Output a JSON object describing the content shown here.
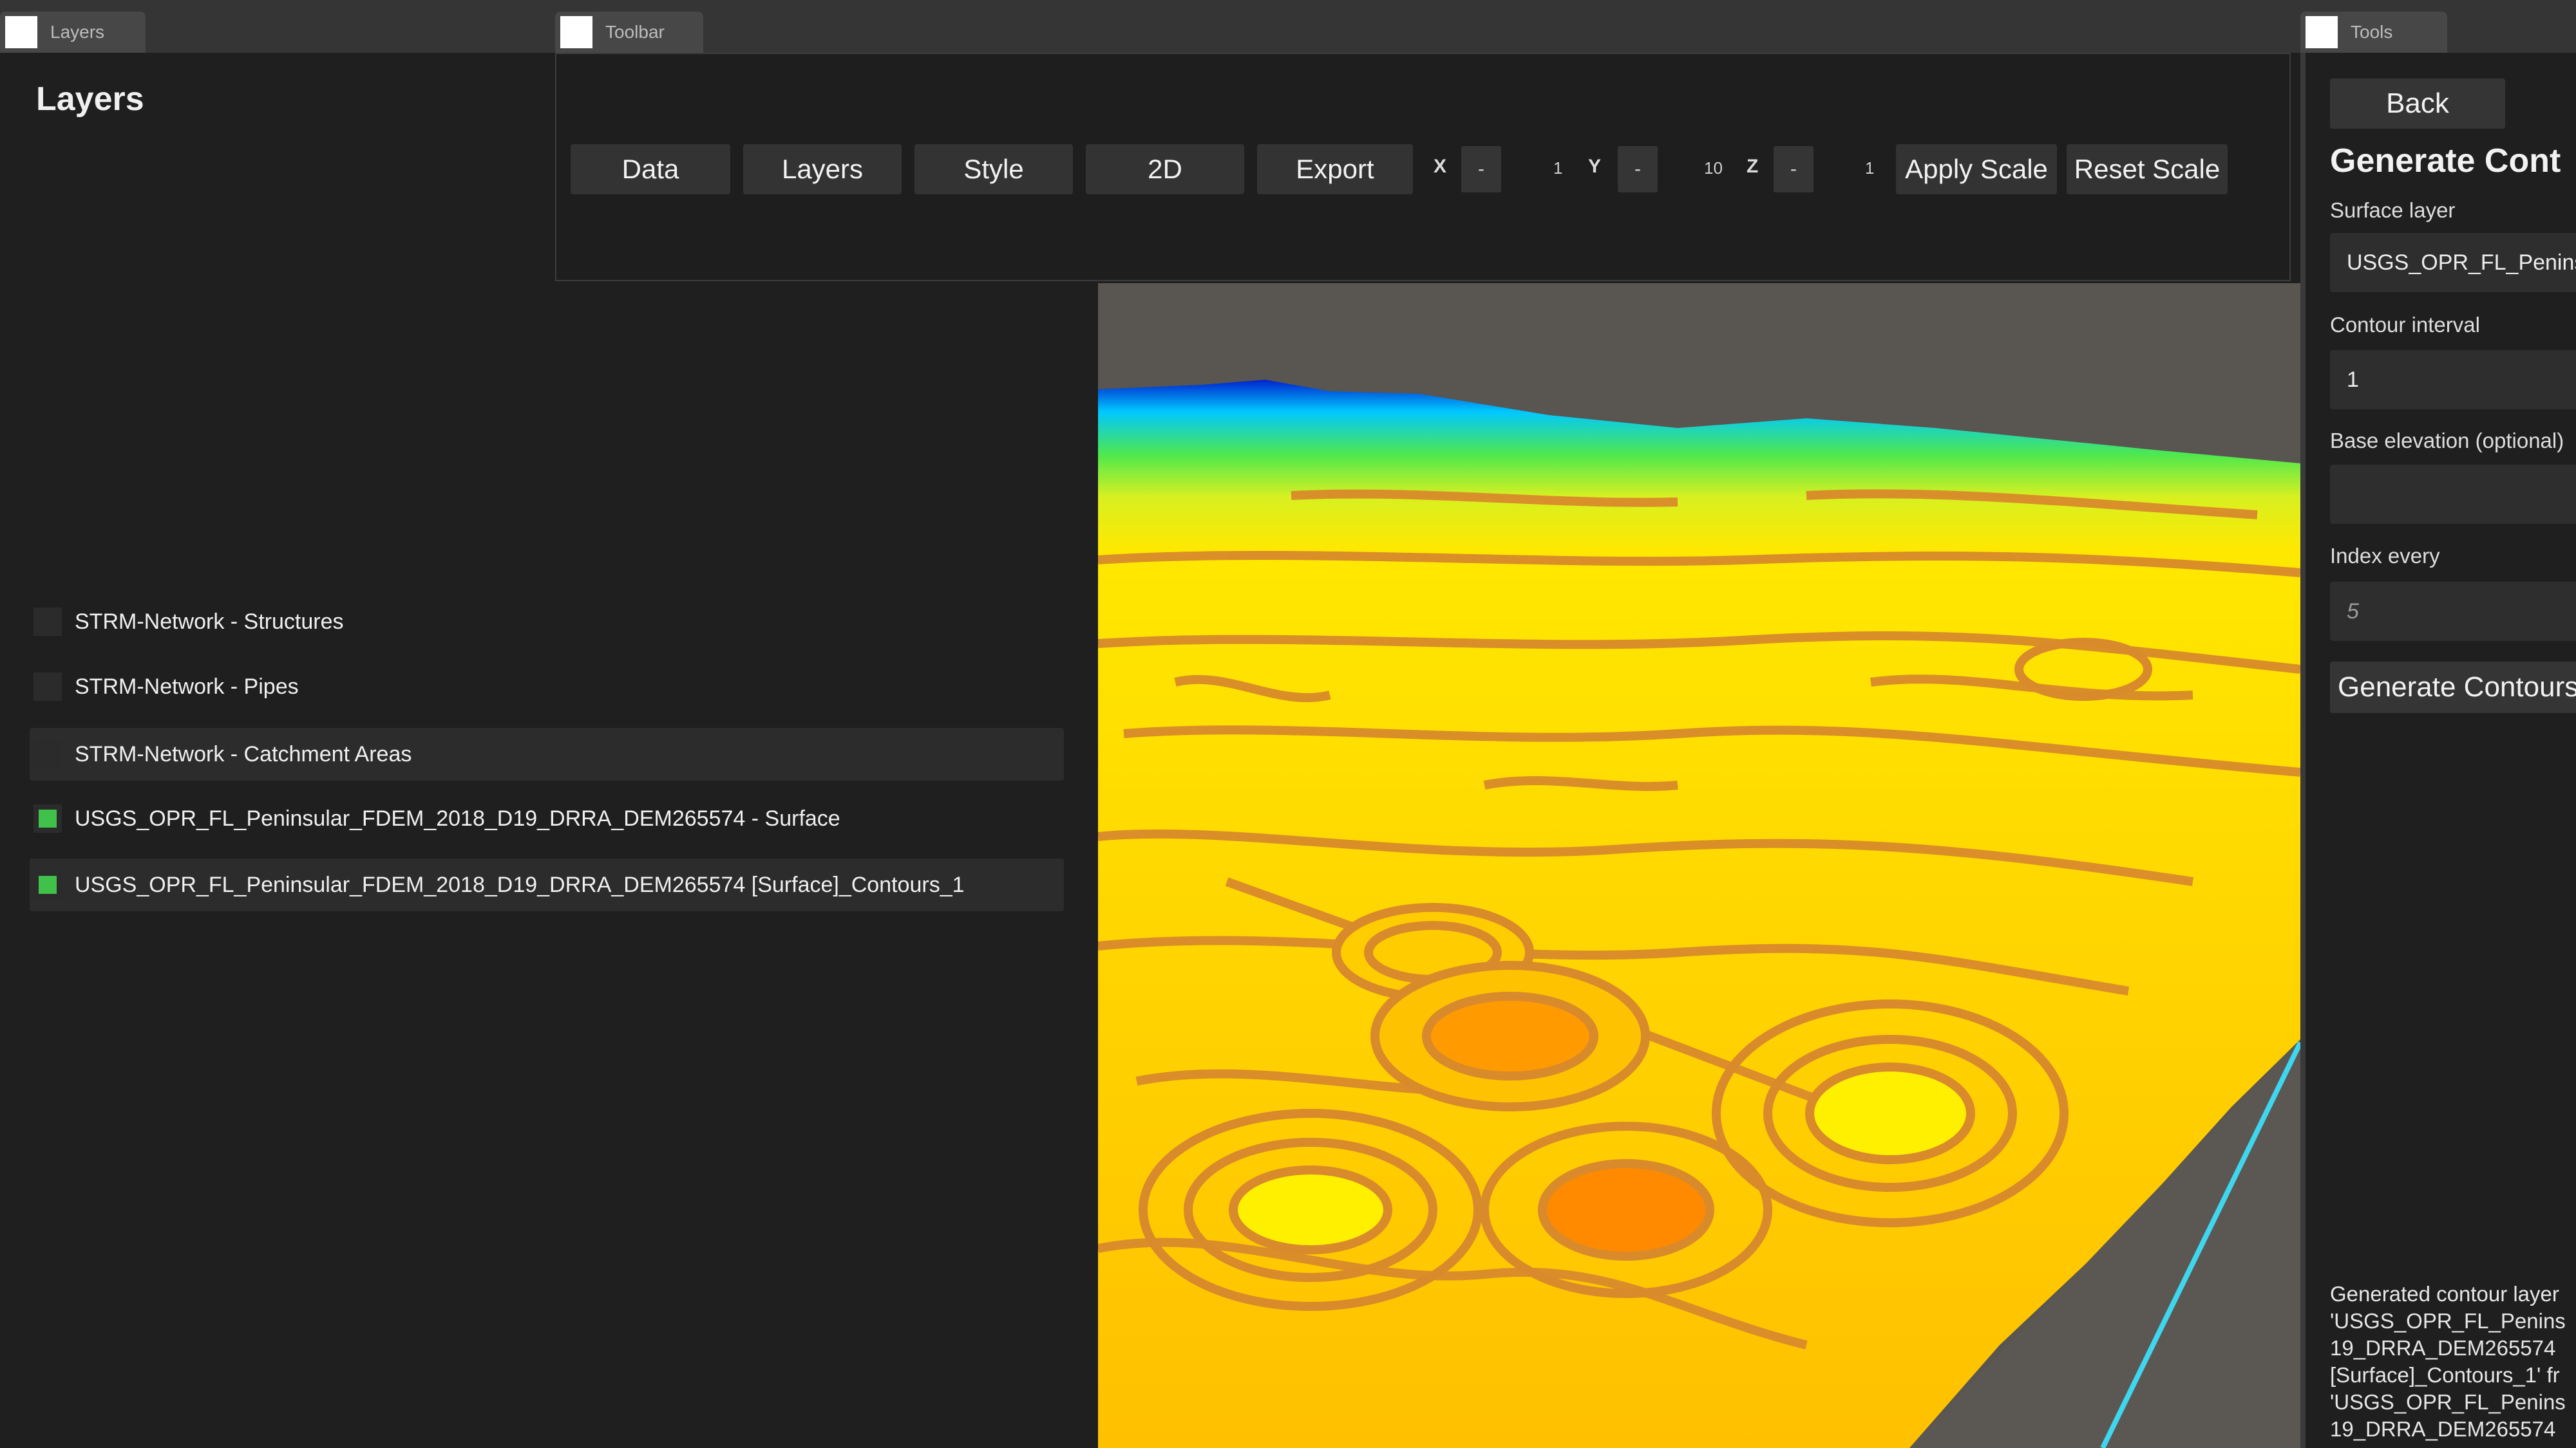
{
  "dock_tabs": {
    "layers": "Layers",
    "toolbar": "Toolbar",
    "tools": "Tools"
  },
  "layers_panel": {
    "title": "Layers",
    "items": [
      {
        "label": "STRM-Network - Structures",
        "visible": false
      },
      {
        "label": "STRM-Network - Pipes",
        "visible": false
      },
      {
        "label": "STRM-Network - Catchment Areas",
        "visible": false
      },
      {
        "label": "USGS_OPR_FL_Peninsular_FDEM_2018_D19_DRRA_DEM265574 - Surface",
        "visible": true
      },
      {
        "label": "USGS_OPR_FL_Peninsular_FDEM_2018_D19_DRRA_DEM265574 [Surface]_Contours_1",
        "visible": true
      }
    ]
  },
  "toolbar": {
    "buttons": [
      "Data",
      "Layers",
      "Style",
      "2D",
      "Export"
    ],
    "scale": {
      "x_label": "X",
      "x_value": "1",
      "y_label": "Y",
      "y_value": "10",
      "z_label": "Z",
      "z_value": "1",
      "stepper": "-"
    },
    "apply_label": "Apply Scale",
    "reset_label": "Reset Scale"
  },
  "tools_panel": {
    "back_label": "Back",
    "title": "Generate Cont",
    "surface_label": "Surface layer",
    "surface_value": "USGS_OPR_FL_Peninsul",
    "interval_label": "Contour interval",
    "interval_value": "1",
    "base_label": "Base elevation (optional)",
    "base_value": "",
    "index_label": "Index every",
    "index_placeholder": "5",
    "generate_label": "Generate Contours",
    "log": "Generated contour layer\n'USGS_OPR_FL_Penins\n19_DRRA_DEM265574\n[Surface]_Contours_1' fr\n'USGS_OPR_FL_Penins\n19_DRRA_DEM265574"
  },
  "colors": {
    "layer_visible": "#3fc14a",
    "panel_bg": "#1f1f1f",
    "terrain_high": "#ffe500",
    "terrain_low": "#0020d0",
    "contour_line": "#d98a2b"
  }
}
